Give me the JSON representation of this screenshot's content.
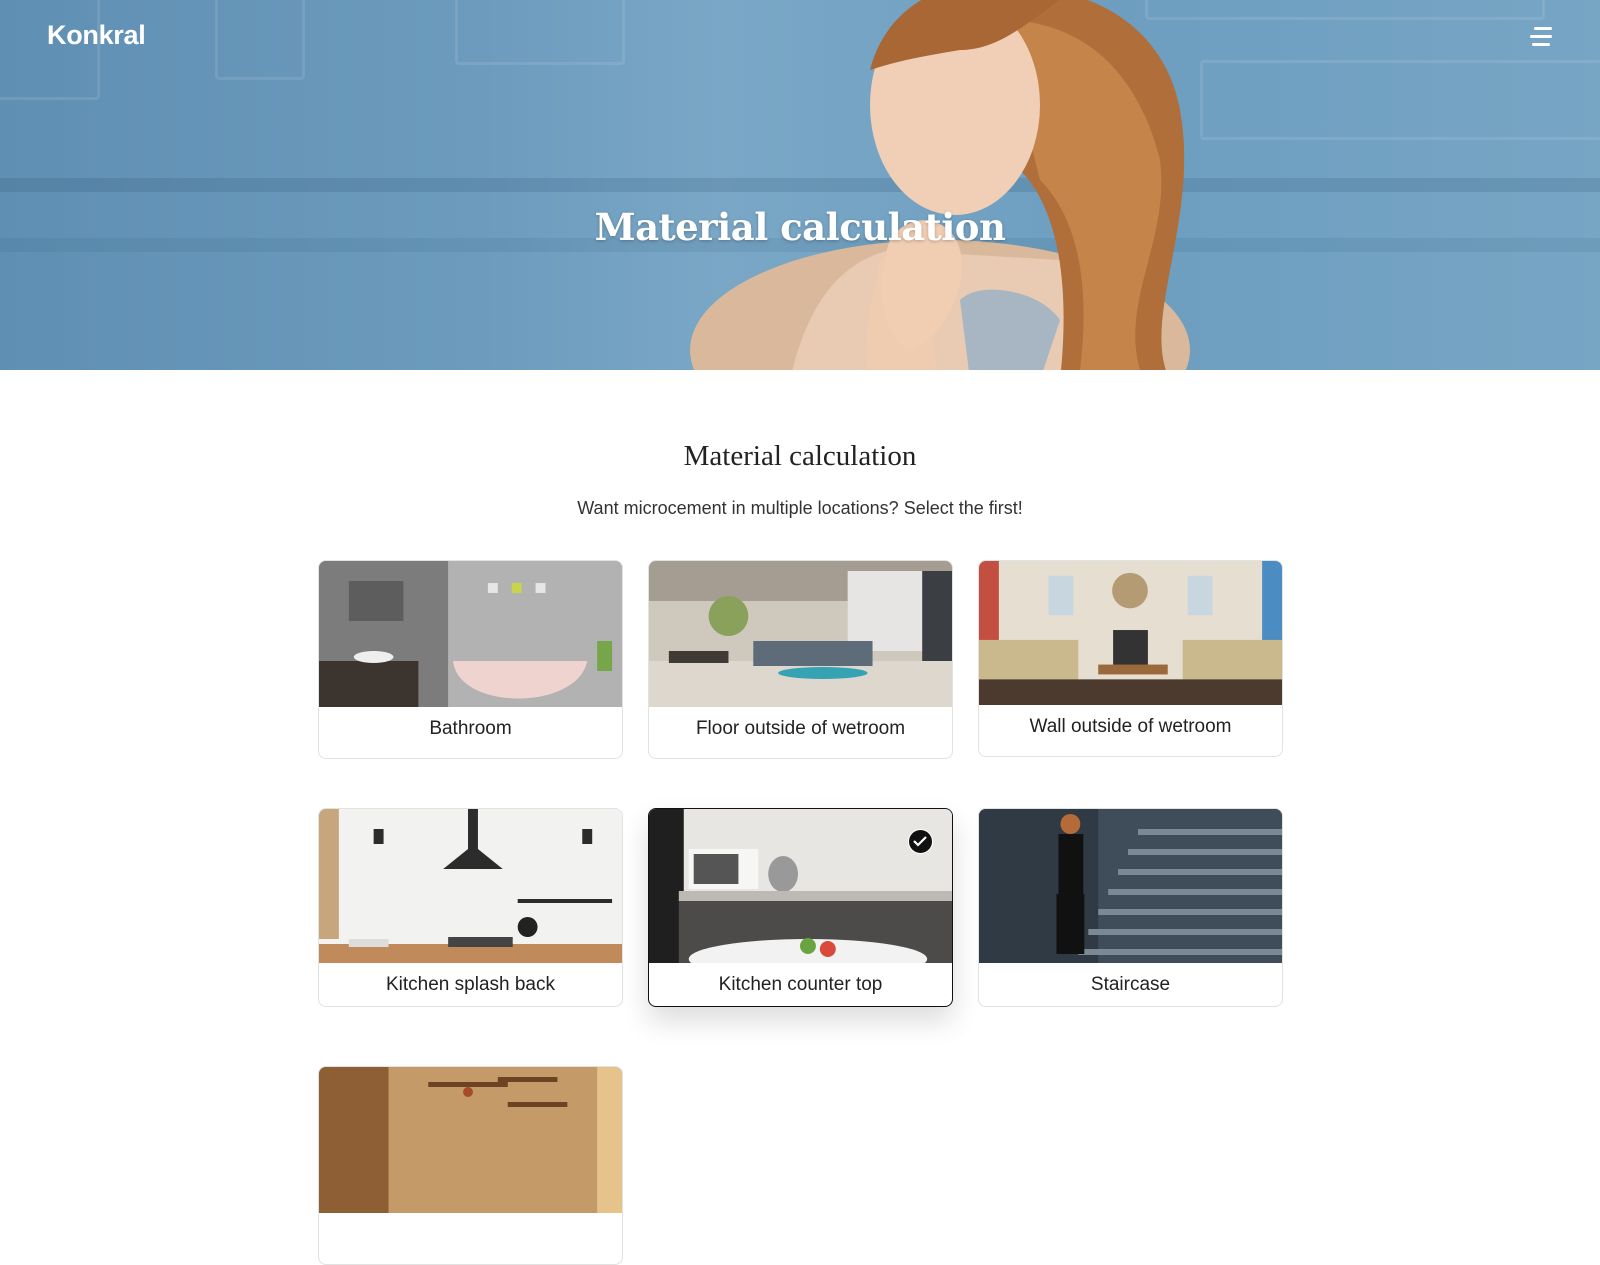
{
  "header": {
    "logo": "Konkral",
    "hero_title": "Material calculation",
    "menu_icon": "hamburger-menu-icon"
  },
  "section": {
    "title": "Material calculation",
    "subtitle": "Want microcement in multiple locations? Select the first!"
  },
  "cards": [
    {
      "label": "Bathroom",
      "selected": false
    },
    {
      "label": "Floor outside of wetroom",
      "selected": false
    },
    {
      "label": "Wall outside of wetroom",
      "selected": false
    },
    {
      "label": "Kitchen splash back",
      "selected": false
    },
    {
      "label": "Kitchen counter top",
      "selected": true
    },
    {
      "label": "Staircase",
      "selected": false
    },
    {
      "label": "",
      "selected": false
    }
  ],
  "colors": {
    "hero_blue": "#6c9bbd",
    "selected_border": "#111111",
    "card_border": "#e2e2e2"
  }
}
